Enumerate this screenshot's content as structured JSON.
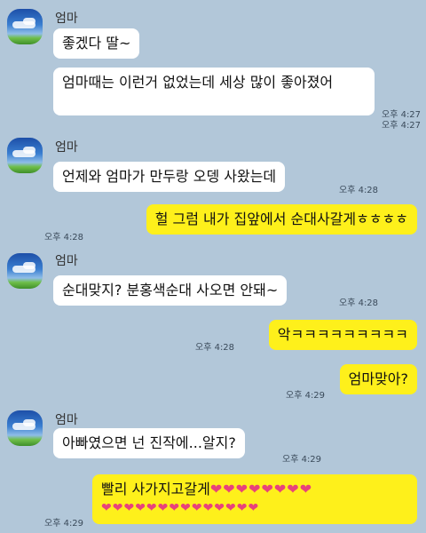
{
  "chat": {
    "sender_name": "엄마",
    "messages": [
      {
        "id": "m1",
        "from": "엄마",
        "text": "좋겠다 딸~"
      },
      {
        "id": "m2",
        "from": "엄마",
        "text": "엄마때는 이런거 없었는데 세상 많이 좋아졌어",
        "time_a": "오후 4:27",
        "time_b": "오후 4:27"
      },
      {
        "id": "m3",
        "from": "엄마",
        "text": "언제와 엄마가 만두랑 오뎅 사왔는데",
        "time": "오후 4:28"
      },
      {
        "id": "m4",
        "from": "me",
        "text": "헐 그럼 내가 집앞에서 순대사갈게ㅎㅎㅎㅎ",
        "time": "오후 4:28"
      },
      {
        "id": "m5",
        "from": "엄마",
        "text": "순대맞지? 분홍색순대 사오면 안돼~",
        "time": "오후 4:28"
      },
      {
        "id": "m6",
        "from": "me",
        "text": "악ㅋㅋㅋㅋㅋㅋㅋㅋㅋ",
        "time": "오후 4:28"
      },
      {
        "id": "m7",
        "from": "me",
        "text": "엄마맞아?",
        "time": "오후 4:29"
      },
      {
        "id": "m8",
        "from": "엄마",
        "text": "아빠였으면 넌 진작에...알지?",
        "time": "오후 4:29"
      },
      {
        "id": "m9",
        "from": "me",
        "text": "빨리 사가지고갈게",
        "hearts_line1": "❤❤❤❤❤❤❤❤",
        "hearts_line2": "❤❤❤❤❤❤❤❤❤❤❤❤❤❤",
        "time": "오후 4:29"
      }
    ]
  },
  "colors": {
    "background": "#b2c7d9",
    "incoming_bubble": "#ffffff",
    "outgoing_bubble": "#fef01b",
    "heart": "#e8427b"
  }
}
